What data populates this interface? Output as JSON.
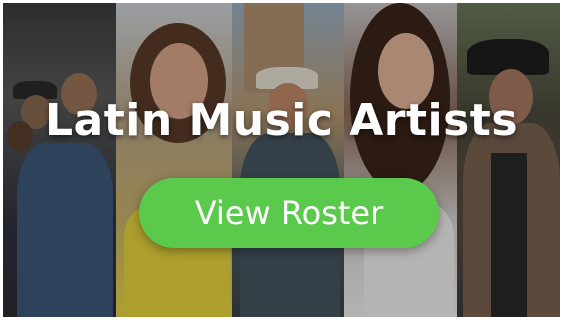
{
  "banner": {
    "title": "Latin Music Artists",
    "button_label": "View Roster",
    "button_color": "#5bc94c"
  }
}
